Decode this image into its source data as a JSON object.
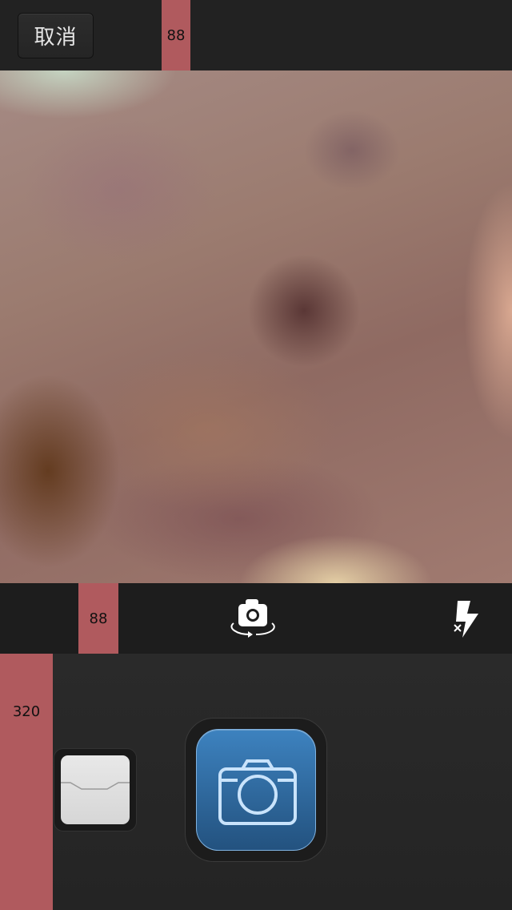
{
  "top_bar": {
    "cancel_label": "取消",
    "marker_label": "88"
  },
  "controls": {
    "marker_label": "88",
    "switch_camera_icon": "camera-switch-icon",
    "flash_icon": "flash-off-icon"
  },
  "bottom": {
    "marker_label": "320",
    "gallery_icon": "photo-library-icon",
    "shutter_icon": "camera-icon",
    "shutter_color": "#2f6ea6"
  },
  "colors": {
    "marker": "#b05a5e",
    "bar_bg": "#222222"
  }
}
